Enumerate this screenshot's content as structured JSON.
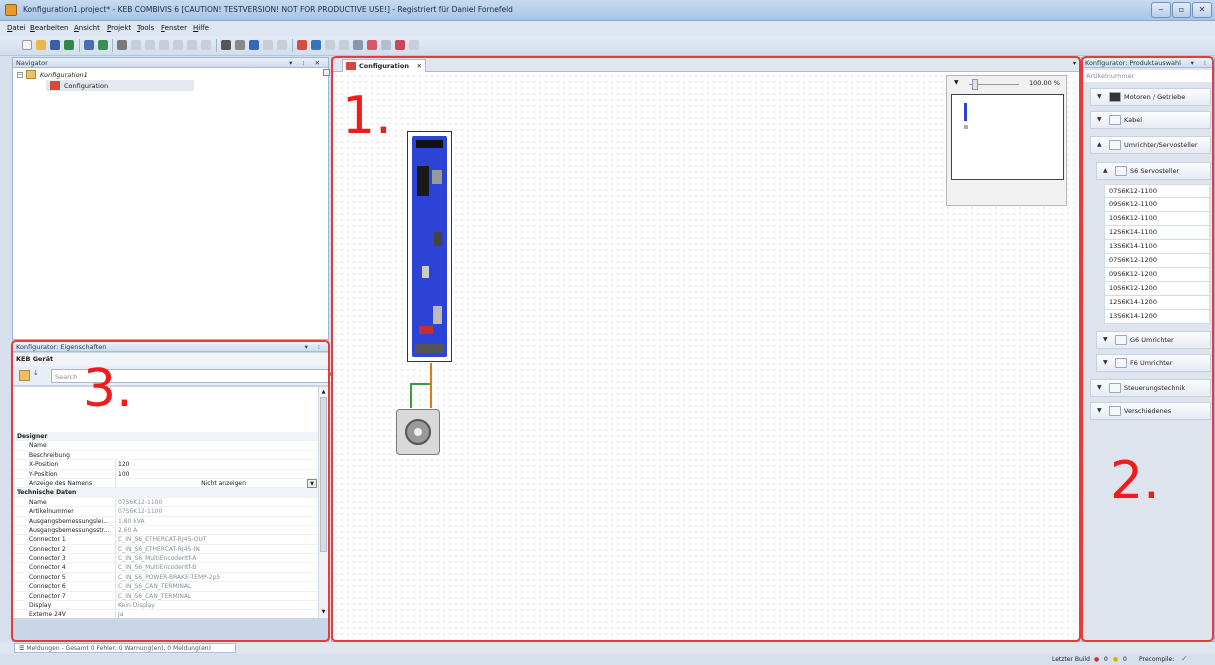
{
  "window": {
    "title": "Konfiguration1.project* - KEB COMBIVIS 6  [CAUTION! TESTVERSION! NOT FOR PRODUCTIVE USE!]  - Registriert für Daniel Fornefeld"
  },
  "menu": [
    "Datei",
    "Bearbeiten",
    "Ansicht",
    "Projekt",
    "Tools",
    "Fenster",
    "Hilfe"
  ],
  "navigator": {
    "title": "Navigator",
    "root": "Konfiguration1",
    "child": "Configuration"
  },
  "annotations": {
    "n1": "1.",
    "n2": "2.",
    "n3": "3."
  },
  "canvas": {
    "tab": "Configuration",
    "zoom": "100.00 %"
  },
  "properties": {
    "title": "Konfigurator: Eigenschaften",
    "object": "KEB Gerät",
    "search_placeholder": "Search",
    "categories": [
      {
        "name": "Designer",
        "rows": [
          {
            "k": "Name",
            "v": ""
          },
          {
            "k": "Beschreibung",
            "v": ""
          },
          {
            "k": "X-Position",
            "v": "120"
          },
          {
            "k": "Y-Position",
            "v": "100"
          },
          {
            "k": "Anzeige des Namens",
            "v": "Nicht anzeigen"
          }
        ]
      },
      {
        "name": "Technische Daten",
        "rows": [
          {
            "k": "Name",
            "v": "07S6K12-1100"
          },
          {
            "k": "Artikelnummer",
            "v": "07S6K12-1100"
          },
          {
            "k": "Ausgangsbemessungslei...",
            "v": "1,80 kVA"
          },
          {
            "k": "Ausgangsbemessungsstr...",
            "v": "2,60 A"
          },
          {
            "k": "Connector 1",
            "v": "C_IN_S6_ETHERCAT-RJ45-OUT"
          },
          {
            "k": "Connector 2",
            "v": "C_IN_S6_ETHERCAT-RJ45-IN"
          },
          {
            "k": "Connector 3",
            "v": "C_IN_S6_MultiEncoderItf-A"
          },
          {
            "k": "Connector 4",
            "v": "C_IN_S6_MultiEncoderItf-B"
          },
          {
            "k": "Connector 5",
            "v": "C_IN_S6_POWER-BRAKE-TEMP-2p5"
          },
          {
            "k": "Connector 6",
            "v": "C_IN_S6_CAN_TERMINAL"
          },
          {
            "k": "Connector 7",
            "v": "C_IN_S6_CAN_TERMINAL"
          },
          {
            "k": "Display",
            "v": "Kein Display"
          },
          {
            "k": "Externe 24V",
            "v": "Ja"
          }
        ]
      }
    ]
  },
  "product": {
    "title": "Konfigurator: Produktauswahl",
    "filter": "Artikelnummer",
    "groups": [
      "Motoren / Getriebe",
      "Kabel",
      "Umrichter/Servosteller"
    ],
    "sub_open": "S6 Servosteller",
    "items": [
      "07S6K12-1100",
      "09S6K12-1100",
      "10S6K12-1100",
      "12S6K14-1100",
      "13S6K14-1100",
      "07S6K12-1200",
      "09S6K12-1200",
      "10S6K12-1200",
      "12S6K14-1200",
      "13S6K14-1200"
    ],
    "sub_closed": [
      "G6 Umrichter",
      "F6 Umrichter"
    ],
    "groups_bottom": [
      "Steuerungstechnik",
      "Verschiedenes"
    ]
  },
  "messages": "Meldungen - Gesamt 0 Fehler, 0 Warnung(en), 0 Meldung(en)",
  "status": {
    "build_label": "Letzter Build",
    "err": "0",
    "warn": "0",
    "precompile": "Precompile:"
  }
}
